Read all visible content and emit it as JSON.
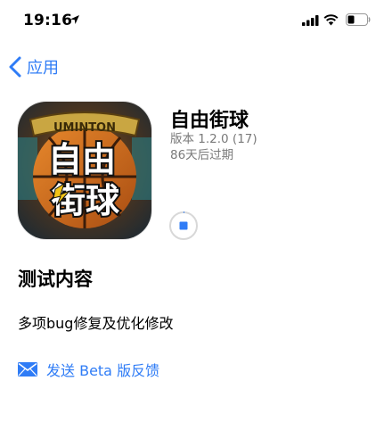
{
  "status_bar": {
    "time": "19:16"
  },
  "nav": {
    "back_label": "应用"
  },
  "app": {
    "name": "自由街球",
    "version": "版本 1.2.0 (17)",
    "expire": "86天后过期",
    "icon_banner_text": "UMINTON",
    "icon_title_top": "自由",
    "icon_title_bottom": "街球"
  },
  "test_content": {
    "title": "测试内容",
    "body": "多项bug修复及优化修改"
  },
  "feedback": {
    "label": "发送 Beta 版反馈"
  },
  "colors": {
    "accent": "#2f7cf6",
    "secondary_text": "#7a7a7a"
  }
}
